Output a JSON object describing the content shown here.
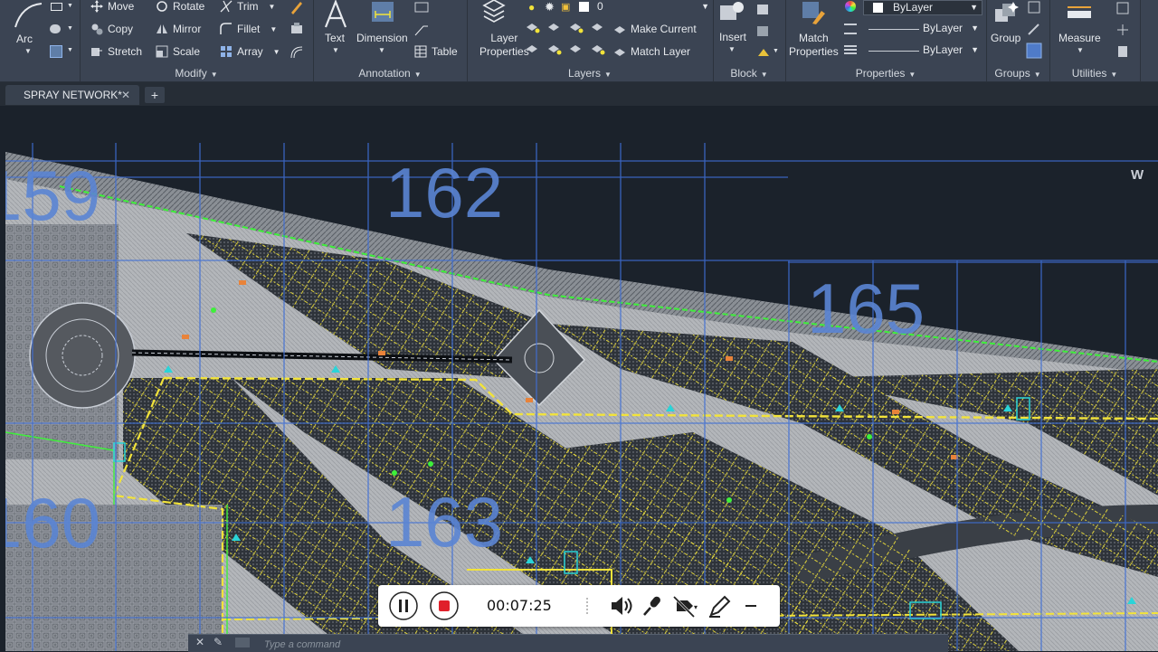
{
  "ribbon": {
    "draw": {
      "arc_label": "Arc"
    },
    "modify": {
      "title": "Modify",
      "move": "Move",
      "rotate": "Rotate",
      "trim": "Trim",
      "copy": "Copy",
      "mirror": "Mirror",
      "fillet": "Fillet",
      "stretch": "Stretch",
      "scale": "Scale",
      "array": "Array"
    },
    "annotation": {
      "title": "Annotation",
      "text": "Text",
      "dimension": "Dimension",
      "table": "Table"
    },
    "layers": {
      "title": "Layers",
      "layer_properties": "Layer\nProperties",
      "current_layer": "0",
      "make_current": "Make Current",
      "match_layer": "Match Layer"
    },
    "block": {
      "title": "Block",
      "insert": "Insert"
    },
    "properties": {
      "title": "Properties",
      "match_properties": "Match\nProperties",
      "color": "ByLayer",
      "linetype": "ByLayer",
      "lineweight": "ByLayer"
    },
    "groups": {
      "title": "Groups",
      "group": "Group"
    },
    "utilities": {
      "title": "Utilities",
      "measure": "Measure"
    }
  },
  "tabs": {
    "file": "SPRAY NETWORK*",
    "new": "+"
  },
  "drawing": {
    "grid_labels": [
      "159",
      "162",
      "165",
      "160",
      "163"
    ],
    "viewcube_letter": "W"
  },
  "recorder": {
    "time": "00:07:25"
  },
  "command": {
    "placeholder": "Type a command"
  },
  "colors": {
    "ribbon": "#3b4453",
    "background": "#1b222b",
    "grid": "#3f6fd6",
    "label": "#5b85d4",
    "yellow": "#f2e33a",
    "green": "#3ef03a",
    "cyan": "#2ad4d8"
  }
}
